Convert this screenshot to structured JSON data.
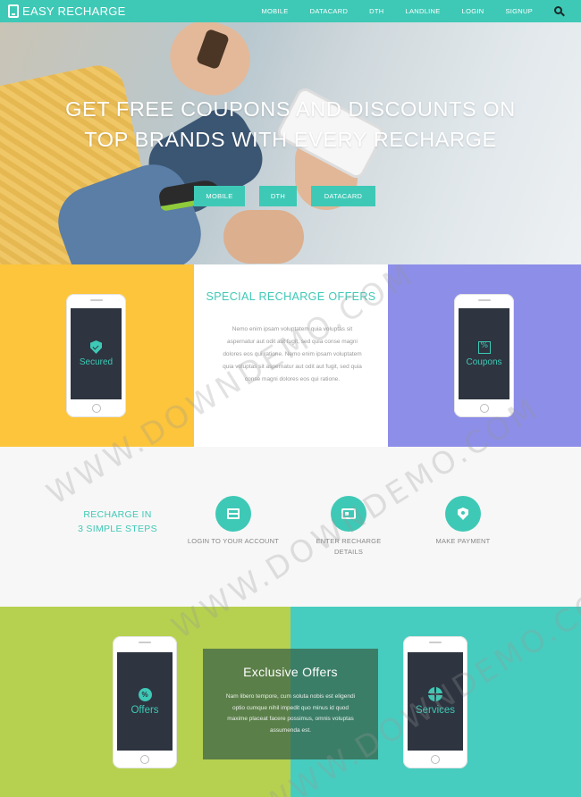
{
  "nav": {
    "brand": "EASY RECHARGE",
    "items": [
      {
        "label": "MOBILE"
      },
      {
        "label": "DATACARD"
      },
      {
        "label": "DTH"
      },
      {
        "label": "LANDLINE"
      },
      {
        "label": "LOGIN"
      },
      {
        "label": "SIGNUP"
      }
    ],
    "search_icon": "search-icon"
  },
  "hero": {
    "title_line1": "GET FREE COUPONS AND DISCOUNTS ON",
    "title_line2": "TOP BRANDS WITH EVERY RECHARGE",
    "buttons": [
      {
        "label": "MOBILE"
      },
      {
        "label": "DTH"
      },
      {
        "label": "DATACARD"
      }
    ]
  },
  "offers": {
    "left_phone": {
      "label": "Secured",
      "icon": "shield-icon"
    },
    "title": "SPECIAL RECHARGE OFFERS",
    "text": "Nemo enim ipsam voluptatem quia voluptas sit aspernatur aut odit aut fugit, sed quia conse magni dolores eos qui ratione. Nemo enim ipsam voluptatem quia voluptas sit aspernatur aut odit aut fugit, sed quia conse magni dolores eos qui ratione.",
    "right_phone": {
      "label": "Coupons",
      "icon": "coupon-icon"
    }
  },
  "steps": {
    "title_line1": "RECHARGE IN",
    "title_line2": "3 SIMPLE STEPS",
    "items": [
      {
        "label": "LOGIN TO YOUR ACCOUNT",
        "icon": "card-icon"
      },
      {
        "label": "ENTER RECHARGE DETAILS",
        "icon": "recharge-icon"
      },
      {
        "label": "MAKE PAYMENT",
        "icon": "payment-shield-icon"
      }
    ]
  },
  "bottom": {
    "left_phone": {
      "label": "Offers",
      "icon": "percent-badge-icon"
    },
    "exclusive_title": "Exclusive Offers",
    "exclusive_text": "Nam libero tempore, cum soluta nobis est eligendi optio cumque nihil impedit quo minus id quod maxime placeat facere possimus, omnis voluptas assumenda est.",
    "right_phone": {
      "label": "Services",
      "icon": "globe-icon"
    }
  },
  "watermark": "WWW.DOWNDEMO.COM",
  "colors": {
    "accent": "#3ec9b6",
    "yellow": "#fcc53b",
    "purple": "#8d8ee8",
    "lime": "#b6d14f",
    "teal": "#47cdbf",
    "screen": "#2e3540"
  }
}
